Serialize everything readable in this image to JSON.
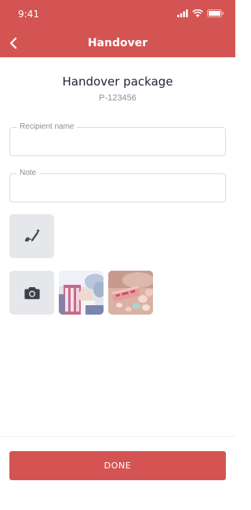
{
  "status_bar": {
    "time": "9:41",
    "icons": [
      "signal-icon",
      "wifi-icon",
      "battery-icon"
    ]
  },
  "nav": {
    "title": "Handover",
    "back_icon": "chevron-left-icon"
  },
  "package": {
    "title": "Handover package",
    "id": "P-123456"
  },
  "form": {
    "recipient_label": "Recipient name",
    "recipient_value": "",
    "note_label": "Note",
    "note_value": ""
  },
  "attachments": {
    "signature_icon": "signature-icon",
    "camera_icon": "camera-icon",
    "photos": [
      "photo-thumbnail-1",
      "photo-thumbnail-2"
    ]
  },
  "footer": {
    "done_label": "DONE"
  },
  "colors": {
    "accent": "#d35452",
    "tile_bg": "#e6e7ea",
    "field_border": "#d7dae0",
    "muted_text": "#8a8f99"
  }
}
